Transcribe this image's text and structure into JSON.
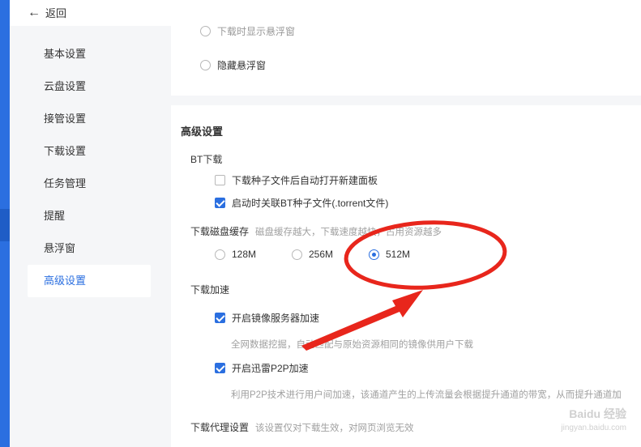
{
  "topbar": {
    "back_label": "返回"
  },
  "sidebar": {
    "items": [
      {
        "label": "基本设置"
      },
      {
        "label": "云盘设置"
      },
      {
        "label": "接管设置"
      },
      {
        "label": "下载设置"
      },
      {
        "label": "任务管理"
      },
      {
        "label": "提醒"
      },
      {
        "label": "悬浮窗"
      },
      {
        "label": "高级设置",
        "active": true
      }
    ]
  },
  "float_window": {
    "option_partial": "下载时显示悬浮窗",
    "option_hide": "隐藏悬浮窗"
  },
  "advanced": {
    "title": "高级设置",
    "bt": {
      "title": "BT下载",
      "opt1": "下载种子文件后自动打开新建面板",
      "opt2": "启动时关联BT种子文件(.torrent文件)"
    },
    "cache": {
      "title": "下载磁盘缓存",
      "hint": "磁盘缓存越大，下载速度越快，占用资源越多",
      "options": [
        "128M",
        "256M",
        "512M"
      ],
      "selected": "512M"
    },
    "accel": {
      "title": "下载加速",
      "mirror_label": "开启镜像服务器加速",
      "mirror_desc": "全网数据挖掘，自动匹配与原始资源相同的镜像供用户下载",
      "p2p_label": "开启迅雷P2P加速",
      "p2p_desc": "利用P2P技术进行用户间加速，该通道产生的上传流量会根据提升通道的带宽，从而提升通道加"
    },
    "proxy": {
      "title": "下载代理设置",
      "hint": "该设置仅对下载生效，对网页浏览无效"
    }
  },
  "watermark": {
    "line1": "Baidu 经验",
    "line2": "jingyan.baidu.com"
  },
  "colors": {
    "accent": "#2b6fe0",
    "annotation": "#e8261c"
  }
}
